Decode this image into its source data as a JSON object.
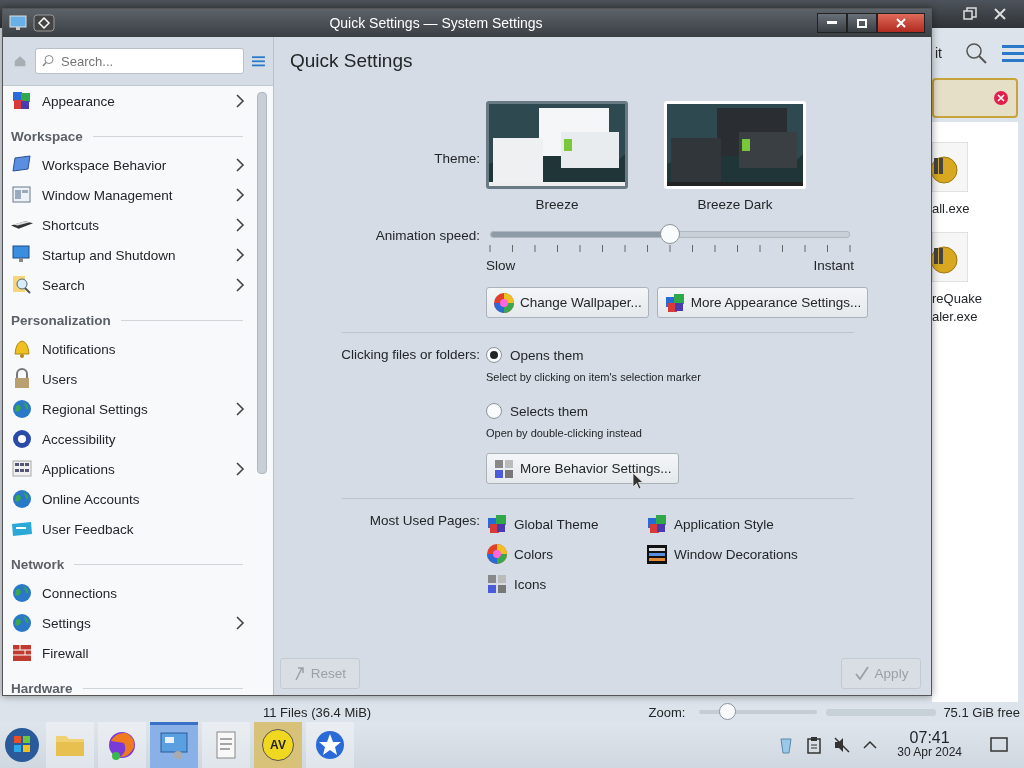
{
  "background_window": {
    "toolbar_text": "it",
    "banner": {
      "closable": true
    },
    "files": [
      {
        "name_lines": [
          "all.exe"
        ]
      },
      {
        "name_lines": [
          "reQuake",
          "aler.exe"
        ]
      }
    ],
    "status_bar": {
      "summary": "11 Files (36.4 MiB)",
      "zoom_label": "Zoom:",
      "zoom": {
        "level": 0.25
      },
      "free_space": "75.1 GiB free"
    }
  },
  "window": {
    "title": "Quick Settings — System Settings"
  },
  "sidebar": {
    "search": {
      "placeholder": "Search..."
    },
    "items": [
      {
        "kind": "item",
        "label": "Appearance",
        "has_children": true
      },
      {
        "kind": "header",
        "label": "Workspace"
      },
      {
        "kind": "item",
        "label": "Workspace Behavior",
        "has_children": true
      },
      {
        "kind": "item",
        "label": "Window Management",
        "has_children": true
      },
      {
        "kind": "item",
        "label": "Shortcuts",
        "has_children": true
      },
      {
        "kind": "item",
        "label": "Startup and Shutdown",
        "has_children": true
      },
      {
        "kind": "item",
        "label": "Search",
        "has_children": true
      },
      {
        "kind": "header",
        "label": "Personalization"
      },
      {
        "kind": "item",
        "label": "Notifications",
        "has_children": false
      },
      {
        "kind": "item",
        "label": "Users",
        "has_children": false
      },
      {
        "kind": "item",
        "label": "Regional Settings",
        "has_children": true
      },
      {
        "kind": "item",
        "label": "Accessibility",
        "has_children": false
      },
      {
        "kind": "item",
        "label": "Applications",
        "has_children": true
      },
      {
        "kind": "item",
        "label": "Online Accounts",
        "has_children": false
      },
      {
        "kind": "item",
        "label": "User Feedback",
        "has_children": false
      },
      {
        "kind": "header",
        "label": "Network"
      },
      {
        "kind": "item",
        "label": "Connections",
        "has_children": false
      },
      {
        "kind": "item",
        "label": "Settings",
        "has_children": true
      },
      {
        "kind": "item",
        "label": "Firewall",
        "has_children": false
      },
      {
        "kind": "header",
        "label": "Hardware"
      }
    ]
  },
  "page": {
    "title": "Quick Settings",
    "theme": {
      "label": "Theme:",
      "options": [
        {
          "name": "Breeze",
          "selected": true,
          "dark": false
        },
        {
          "name": "Breeze Dark",
          "selected": false,
          "dark": true
        }
      ]
    },
    "animation": {
      "label": "Animation speed:",
      "level": 0.5,
      "min_label": "Slow",
      "max_label": "Instant"
    },
    "appearance_buttons": [
      "Change Wallpaper...",
      "More Appearance Settings..."
    ],
    "clicking": {
      "label": "Clicking files or folders:",
      "options": [
        {
          "label": "Opens them",
          "hint": "Select by clicking on item's selection marker",
          "selected": true
        },
        {
          "label": "Selects them",
          "hint": "Open by double-clicking instead",
          "selected": false
        }
      ]
    },
    "behavior_button": "More Behavior Settings...",
    "most_used": {
      "label": "Most Used Pages:",
      "pages": [
        "Global Theme",
        "Application Style",
        "Colors",
        "Window Decorations",
        "Icons"
      ]
    },
    "footer": {
      "reset": {
        "label": "Reset",
        "disabled": true
      },
      "apply": {
        "label": "Apply",
        "disabled": true
      }
    }
  },
  "taskbar": {
    "apps": [
      {
        "selected": false,
        "attention": false
      },
      {
        "selected": false,
        "attention": false
      },
      {
        "selected": true,
        "attention": false
      },
      {
        "selected": false,
        "attention": false
      },
      {
        "selected": false,
        "attention": true,
        "logo_text": "AV"
      },
      {
        "selected": false,
        "attention": false
      }
    ],
    "tray": {
      "muted": true
    },
    "clock": {
      "time": "07:41",
      "date": "30 Apr 2024"
    }
  }
}
